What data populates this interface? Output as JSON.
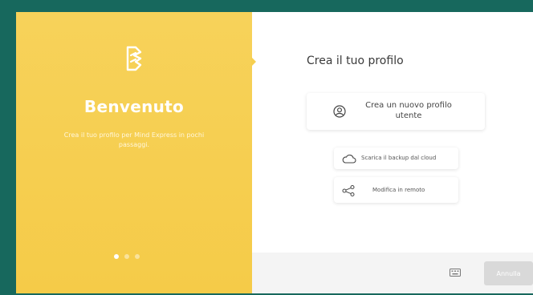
{
  "welcome": {
    "title": "Benvenuto",
    "subtitle": "Crea il tuo profilo per Mind Express in pochi passaggi."
  },
  "carousel": {
    "total": 3,
    "active_index": 0
  },
  "main": {
    "title": "Crea il tuo profilo",
    "create_new_profile": "Crea un nuovo profilo utente",
    "download_backup": "Scarica il backup dal cloud",
    "remote_edit": "Modifica in remoto"
  },
  "footer": {
    "cancel": "Annulla"
  },
  "colors": {
    "background": "#17685d",
    "accent_yellow": "#f5cb48",
    "disabled_button": "#d9d9d9"
  },
  "icons": {
    "logo": "mind-express-logo",
    "profile": "user-circle-icon",
    "cloud": "cloud-icon",
    "share": "share-icon",
    "keyboard": "keyboard-icon"
  }
}
